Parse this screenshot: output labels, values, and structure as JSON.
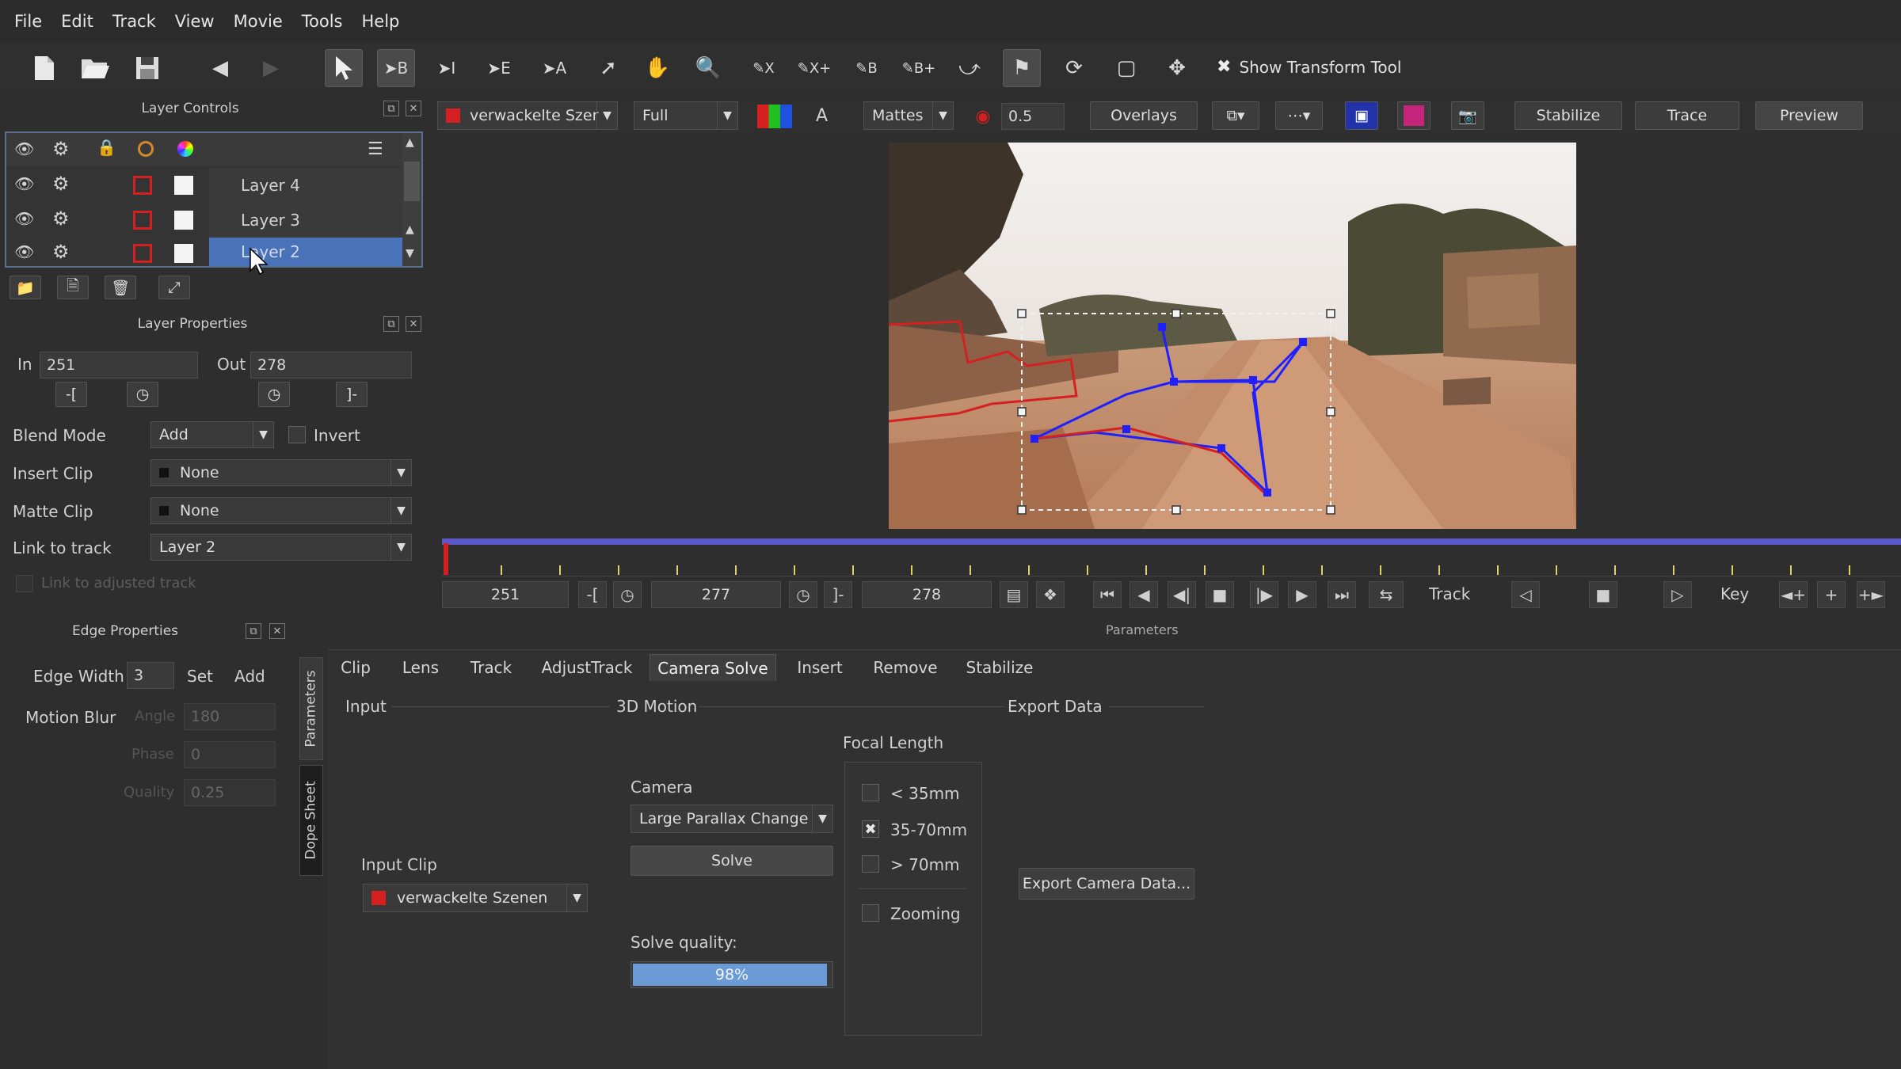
{
  "menu": [
    "File",
    "Edit",
    "Track",
    "View",
    "Movie",
    "Tools",
    "Help"
  ],
  "toolbar": {
    "tool_labels": [
      "B",
      "I",
      "E",
      "A",
      "X",
      "X+",
      "B",
      "B+"
    ],
    "show_transform_label": "Show Transform Tool",
    "show_transform_checked": true
  },
  "layer_controls": {
    "title": "Layer Controls",
    "layers": [
      {
        "name": "Layer 4",
        "selected": false
      },
      {
        "name": "Layer 3",
        "selected": false
      },
      {
        "name": "Layer 2",
        "selected": true
      }
    ]
  },
  "layer_properties": {
    "title": "Layer Properties",
    "in_label": "In",
    "in_value": "251",
    "out_label": "Out",
    "out_value": "278",
    "blend_mode_label": "Blend Mode",
    "blend_mode_value": "Add",
    "invert_label": "Invert",
    "insert_clip_label": "Insert Clip",
    "insert_clip_value": "None",
    "matte_clip_label": "Matte Clip",
    "matte_clip_value": "None",
    "link_to_track_label": "Link to track",
    "link_to_track_value": "Layer 2",
    "link_adjusted_label": "Link to adjusted track"
  },
  "edge_properties": {
    "title": "Edge Properties",
    "edge_width_label": "Edge Width",
    "edge_width_value": "3",
    "set_label": "Set",
    "add_label": "Add",
    "motion_blur_label": "Motion Blur",
    "angle_label": "Angle",
    "angle_value": "180",
    "phase_label": "Phase",
    "phase_value": "0",
    "quality_label": "Quality",
    "quality_value": "0.25"
  },
  "viewer_bar": {
    "clip_name": "verwackelte Szer",
    "resolution": "Full",
    "channel_label": "A",
    "mattes_label": "Mattes",
    "opacity_value": "0.5",
    "overlays_label": "Overlays",
    "stabilize_label": "Stabilize",
    "trace_label": "Trace",
    "preview_label": "Preview"
  },
  "timeline": {
    "start_frame": "251",
    "current_frame": "277",
    "end_frame": "278",
    "track_label": "Track",
    "key_label": "Key",
    "params_label": "Parameters"
  },
  "params_tabs": [
    "Clip",
    "Lens",
    "Track",
    "AdjustTrack",
    "Camera Solve",
    "Insert",
    "Remove",
    "Stabilize"
  ],
  "active_tab": "Camera Solve",
  "side_tabs": [
    "Parameters",
    "Dope Sheet"
  ],
  "camera_solve": {
    "input_section": "Input",
    "motion_section": "3D Motion",
    "export_section": "Export Data",
    "focal_length_label": "Focal Length",
    "camera_label": "Camera",
    "camera_value": "Large Parallax Change",
    "solve_label": "Solve",
    "solve_quality_label": "Solve quality:",
    "solve_quality_value": "98%",
    "solve_quality_fraction": 0.98,
    "input_clip_label": "Input Clip",
    "input_clip_value": "verwackelte Szenen",
    "focal_options": [
      {
        "label": "< 35mm",
        "checked": false
      },
      {
        "label": "35-70mm",
        "checked": true
      },
      {
        "label": "> 70mm",
        "checked": false
      },
      {
        "label": "Zooming",
        "checked": false
      }
    ],
    "export_button": "Export Camera Data..."
  },
  "colors": {
    "accent_red": "#d42020",
    "timeline_bar": "#5a57c8",
    "tick": "#d7d26a",
    "layer_selected": "#4a72b8",
    "tracker_blue": "#2020ff",
    "progress": "#6a9bd6"
  }
}
